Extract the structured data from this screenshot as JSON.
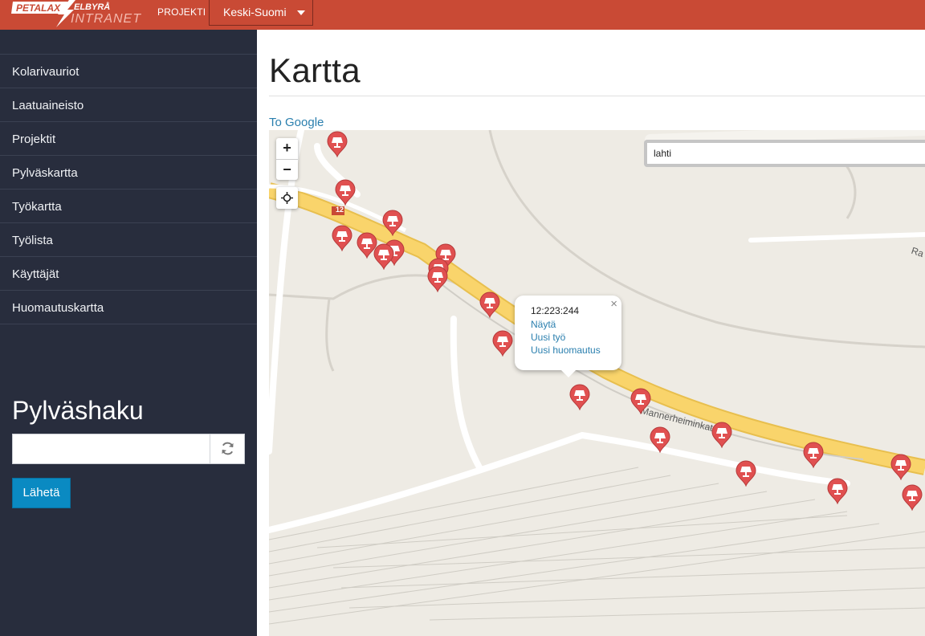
{
  "header": {
    "logo_main": "PETALAX",
    "logo_sub": "ELBYRÅ",
    "logo_intranet": "INTRANET",
    "project_label": "PROJEKTI *",
    "project_selected": "Keski-Suomi"
  },
  "sidebar": {
    "items": [
      {
        "label": "Kolarivauriot"
      },
      {
        "label": "Laatuaineisto"
      },
      {
        "label": "Projektit"
      },
      {
        "label": "Pylväskartta"
      },
      {
        "label": "Työkartta"
      },
      {
        "label": "Työlista"
      },
      {
        "label": "Käyttäjät"
      },
      {
        "label": "Huomautuskartta"
      }
    ],
    "search_title": "Pylväshaku",
    "search_value": "",
    "submit_label": "Lähetä"
  },
  "main": {
    "title": "Kartta",
    "google_link": "To Google"
  },
  "map": {
    "zoom_in": "+",
    "zoom_out": "−",
    "search_value": "lahti",
    "road_number": "12",
    "street_name": "Mannerheiminkatu",
    "street_fragment_right": "Ra",
    "popup": {
      "pole_id": "12:223:244",
      "link_show": "Näytä",
      "link_new_work": "Uusi työ",
      "link_new_note": "Uusi huomautus",
      "close": "×"
    },
    "colors": {
      "marker": "#e05050",
      "highway": "#f9d46b",
      "land": "#eeebe4"
    }
  }
}
